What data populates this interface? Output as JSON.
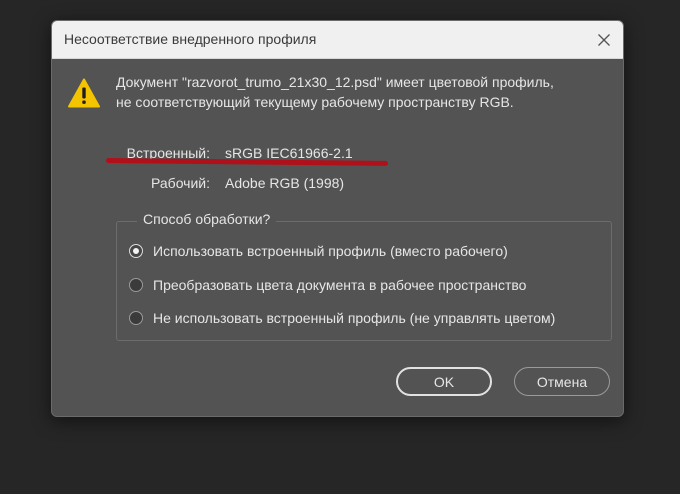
{
  "dialog": {
    "title": "Несоответствие внедренного профиля",
    "close_icon": "close-icon",
    "warning_icon": "warning-triangle-icon",
    "message_line1": "Документ \"razvorot_trumo_21x30_12.psd\" имеет цветовой профиль,",
    "message_line2": "не соответствующий текущему рабочему пространству RGB.",
    "embedded_label": "Встроенный:",
    "embedded_value": "sRGB IEC61966-2.1",
    "working_label": "Рабочий:",
    "working_value": "Adobe RGB (1998)",
    "options_legend": "Способ обработки?",
    "options": [
      {
        "label": "Использовать встроенный профиль (вместо рабочего)",
        "selected": true
      },
      {
        "label": "Преобразовать цвета документа в рабочее пространство",
        "selected": false
      },
      {
        "label": "Не использовать встроенный профиль (не управлять цветом)",
        "selected": false
      }
    ],
    "ok_label": "OK",
    "cancel_label": "Отмена"
  },
  "colors": {
    "background": "#262626",
    "dialog_bg": "#535353",
    "titlebar_bg": "#f0f0f0",
    "warning_yellow": "#f5c400",
    "annotation_red": "#b0101a"
  }
}
